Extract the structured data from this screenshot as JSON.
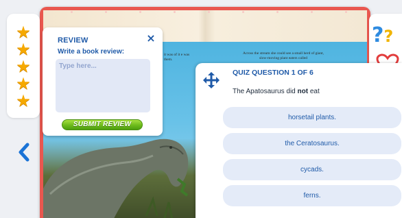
{
  "book": {
    "left_text": "it was of it e was them.",
    "right_text": "Across the stream she could see a small herd of giant, slow-moving plant eaters called"
  },
  "rating": {
    "stars": 5,
    "max": 5,
    "icon": "star-icon",
    "color": "#f6a900"
  },
  "navigation": {
    "back_icon": "chevron-left-icon"
  },
  "side_tools": {
    "help_icon": "question-marks-icon",
    "help_glyph_1": "?",
    "help_glyph_2": "?",
    "favorite_icon": "heart-icon"
  },
  "review": {
    "title": "REVIEW",
    "prompt": "Write a book review:",
    "placeholder": "Type here...",
    "value": "",
    "submit_label": "SUBMIT REVIEW",
    "close_icon": "close-icon",
    "close_glyph": "×",
    "accent_color": "#1f5aa8"
  },
  "quiz": {
    "title": "QUIZ QUESTION 1 OF 6",
    "question_prefix": "The Apatosaurus did",
    "question_emphasis": "not",
    "question_suffix": "eat",
    "move_icon": "move-icon",
    "answers": [
      "horsetail plants.",
      "the Ceratosaurus.",
      "cycads.",
      "ferns."
    ]
  },
  "colors": {
    "book_border": "#e9574f",
    "answer_bg": "#e4ebf8",
    "submit_green": "#6dbb1c"
  }
}
